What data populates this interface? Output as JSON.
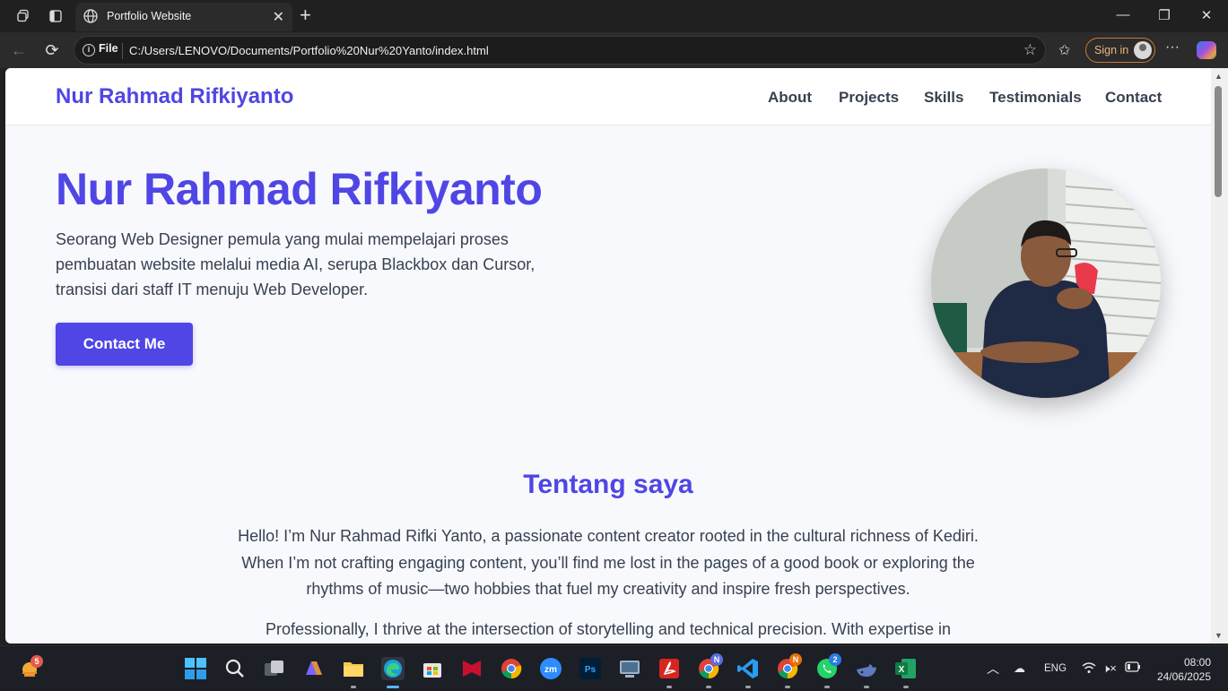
{
  "browser": {
    "tab_title": "Portfolio Website",
    "address_scheme": "File",
    "address_url": "C:/Users/LENOVO/Documents/Portfolio%20Nur%20Yanto/index.html",
    "signin_label": "Sign in"
  },
  "site": {
    "brand": "Nur Rahmad Rifkiyanto",
    "nav": [
      "About",
      "Projects",
      "Skills",
      "Testimonials",
      "Contact"
    ],
    "hero": {
      "title": "Nur Rahmad Rifkiyanto",
      "lines": [
        "Seorang Web Designer pemula yang mulai mempelajari proses",
        "pembuatan website melalui media AI, serupa Blackbox dan Cursor,",
        "transisi dari staff IT menuju Web Developer."
      ],
      "cta": "Contact Me"
    },
    "about": {
      "title": "Tentang saya",
      "p1_lines": [
        "Hello! I’m Nur Rahmad Rifki Yanto, a passionate content creator rooted in the cultural richness of Kediri.",
        "When I’m not crafting engaging content, you’ll find me lost in the pages of a good book or exploring the",
        "rhythms of music—two hobbies that fuel my creativity and inspire fresh perspectives."
      ],
      "p2_lines": [
        "Professionally, I thrive at the intersection of storytelling and technical precision. With expertise in"
      ]
    }
  },
  "taskbar": {
    "widget_badge": "5",
    "chrome_profile_1": "N",
    "chrome_profile_2": "N",
    "whatsapp_badge": "2",
    "language": "ENG",
    "time": "08:00",
    "date": "24/06/2025"
  },
  "colors": {
    "accent": "#4f46e5",
    "text": "#374151",
    "page_bg": "#f8f9fc"
  }
}
